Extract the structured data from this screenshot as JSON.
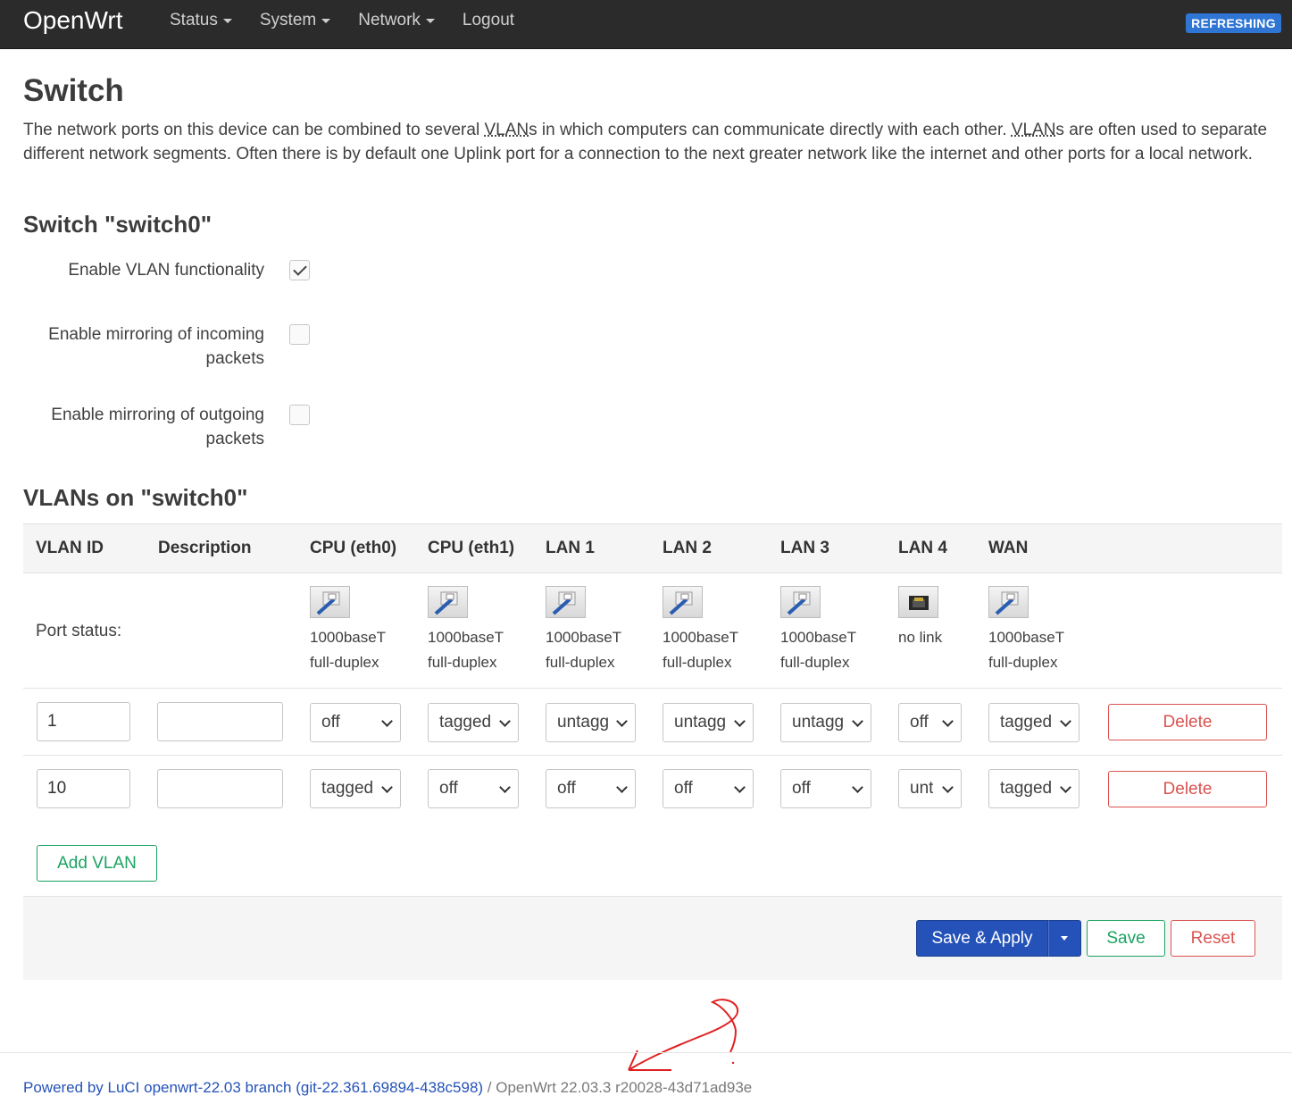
{
  "header": {
    "brand": "OpenWrt",
    "menu": [
      {
        "label": "Status",
        "dropdown": true
      },
      {
        "label": "System",
        "dropdown": true
      },
      {
        "label": "Network",
        "dropdown": true
      },
      {
        "label": "Logout",
        "dropdown": false
      }
    ],
    "indicator": "REFRESHING"
  },
  "page": {
    "title": "Switch",
    "description": {
      "p1": "The network ports on this device can be combined to several ",
      "abbr1": "VLAN",
      "p2": "s in which computers can communicate directly with each other. ",
      "abbr2": "VLAN",
      "p3": "s are often used to separate different network segments. Often there is by default one Uplink port for a connection to the next greater network like the internet and other ports for a local network."
    }
  },
  "switch_section": {
    "title": "Switch \"switch0\"",
    "options": [
      {
        "label": "Enable VLAN functionality",
        "checked": true
      },
      {
        "label": "Enable mirroring of incoming packets",
        "checked": false
      },
      {
        "label": "Enable mirroring of outgoing packets",
        "checked": false
      }
    ]
  },
  "vlan_section": {
    "title": "VLANs on \"switch0\"",
    "columns": [
      "VLAN ID",
      "Description",
      "CPU (eth0)",
      "CPU (eth1)",
      "LAN 1",
      "LAN 2",
      "LAN 3",
      "LAN 4",
      "WAN"
    ],
    "port_status_label": "Port status:",
    "ports": [
      {
        "line1": "1000baseT",
        "line2": "full-duplex",
        "link": true
      },
      {
        "line1": "1000baseT",
        "line2": "full-duplex",
        "link": true
      },
      {
        "line1": "1000baseT",
        "line2": "full-duplex",
        "link": true
      },
      {
        "line1": "1000baseT",
        "line2": "full-duplex",
        "link": true
      },
      {
        "line1": "1000baseT",
        "line2": "full-duplex",
        "link": true
      },
      {
        "line1": "no link",
        "line2": "",
        "link": false
      },
      {
        "line1": "1000baseT",
        "line2": "full-duplex",
        "link": true
      }
    ],
    "vlans": [
      {
        "id": "1",
        "description": "",
        "ports": [
          "off",
          "tagged",
          "untagg",
          "untagg",
          "untagg",
          "off",
          "tagged"
        ],
        "delete_label": "Delete"
      },
      {
        "id": "10",
        "description": "",
        "ports": [
          "tagged",
          "off",
          "off",
          "off",
          "off",
          "unt",
          "tagged"
        ],
        "delete_label": "Delete"
      }
    ],
    "add_label": "Add VLAN"
  },
  "actions": {
    "save_apply": "Save & Apply",
    "save": "Save",
    "reset": "Reset"
  },
  "footer": {
    "link": "Powered by LuCI openwrt-22.03 branch (git-22.361.69894-438c598)",
    "separator": " / ",
    "version": "OpenWrt 22.03.3 r20028-43d71ad93e"
  },
  "colors": {
    "navbar": "#2b2b2b",
    "primary": "#2552b8",
    "positive": "#1ba361",
    "negative": "#d9534f",
    "annotation": "#e02020"
  }
}
